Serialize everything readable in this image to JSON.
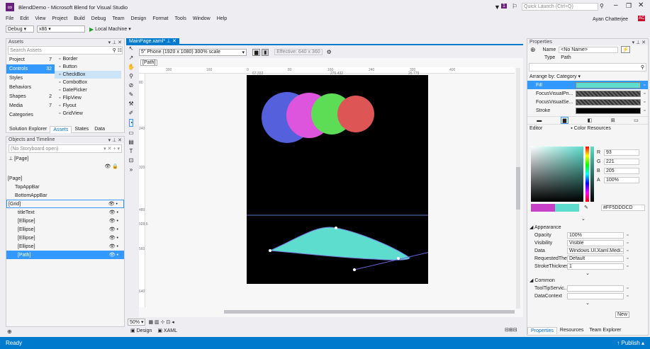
{
  "titlebar": {
    "title": "BlendDemo - Microsoft Blend for Visual Studio",
    "quick_launch": "Quick Launch (Ctrl+Q)",
    "user": "Ayan Chatterjee",
    "user_initials": "AC",
    "notif_count": "1"
  },
  "menu": [
    "File",
    "Edit",
    "View",
    "Project",
    "Build",
    "Debug",
    "Team",
    "Design",
    "Format",
    "Tools",
    "Window",
    "Help"
  ],
  "toolbar": {
    "config": "Debug",
    "platform": "x86",
    "run": "Local Machine"
  },
  "assets": {
    "title": "Assets",
    "search_placeholder": "Search Assets",
    "categories": [
      {
        "label": "Project",
        "count": "7"
      },
      {
        "label": "Controls",
        "count": "32"
      },
      {
        "label": "Styles",
        "count": ""
      },
      {
        "label": "Behaviors",
        "count": ""
      },
      {
        "label": "Shapes",
        "count": "2"
      },
      {
        "label": "Media",
        "count": "7"
      },
      {
        "label": "Categories",
        "count": ""
      }
    ],
    "items": [
      "Border",
      "Button",
      "CheckBox",
      "ComboBox",
      "DatePicker",
      "FlipView",
      "Flyout",
      "GridView"
    ],
    "tabs": [
      "Solution Explorer",
      "Assets",
      "States",
      "Data"
    ]
  },
  "objects": {
    "title": "Objects and Timeline",
    "storyboard": "(No Storyboard open)",
    "page": "[Page]",
    "tree": [
      "[Page]",
      "TopAppBar",
      "BottomAppBar",
      "[Grid]",
      "titleText",
      "[Ellipse]",
      "[Ellipse]",
      "[Ellipse]",
      "[Ellipse]",
      "[Path]"
    ]
  },
  "doc": {
    "tab": "MainPage.xaml*",
    "device": "5\" Phone (1920 x 1080) 300% scale",
    "effective": "Effective: 640 x 360",
    "path_tag": "[Path]",
    "zoom": "50%",
    "view_tabs": [
      "Design",
      "XAML"
    ],
    "ruler_top": [
      "300",
      "160",
      "0",
      "80",
      "160",
      "240",
      "320",
      "400"
    ],
    "ruler_readouts": [
      "67.333",
      "276.432",
      "26.779"
    ],
    "ruler_left": [
      "80",
      "240",
      "320",
      "480",
      "528.5",
      "560",
      "640"
    ]
  },
  "properties": {
    "title": "Properties",
    "name_label": "Name",
    "name_value": "<No Name>",
    "type_label": "Type",
    "type_value": "Path",
    "arrange": "Arrange by: Category",
    "brushes": [
      {
        "label": "Fill",
        "color": "#5DDDCD"
      },
      {
        "label": "FocusVisualPri...",
        "color": ""
      },
      {
        "label": "FocusVisualSe...",
        "color": ""
      },
      {
        "label": "Stroke",
        "color": "#000000"
      }
    ],
    "editor_label": "Editor",
    "color_resources": "Color Resources",
    "rgba": [
      {
        "ch": "R",
        "val": "93"
      },
      {
        "ch": "G",
        "val": "221"
      },
      {
        "ch": "B",
        "val": "205"
      },
      {
        "ch": "A",
        "val": "100%"
      }
    ],
    "hex": "#FF5DDDCD",
    "appearance_title": "Appearance",
    "appearance": [
      {
        "label": "Opacity",
        "value": "100%"
      },
      {
        "label": "Visibility",
        "value": "Visible"
      },
      {
        "label": "Data",
        "value": "Windows.UI.Xaml.Medi..."
      },
      {
        "label": "RequestedThe...",
        "value": "Default"
      },
      {
        "label": "StrokeThickness",
        "value": "1"
      }
    ],
    "common_title": "Common",
    "common": [
      {
        "label": "ToolTipServic...",
        "value": ""
      },
      {
        "label": "DataContext",
        "value": ""
      }
    ],
    "new_button": "New",
    "tabs": [
      "Properties",
      "Resources",
      "Team Explorer"
    ]
  },
  "canvas": {
    "ellipse_colors": [
      "#5560dd",
      "#dd55dd",
      "#5ddd55",
      "#dd5555"
    ],
    "path_fill": "#5DDDCD",
    "background": "#000000"
  },
  "status": {
    "text": "Ready",
    "publish": "Publish"
  }
}
